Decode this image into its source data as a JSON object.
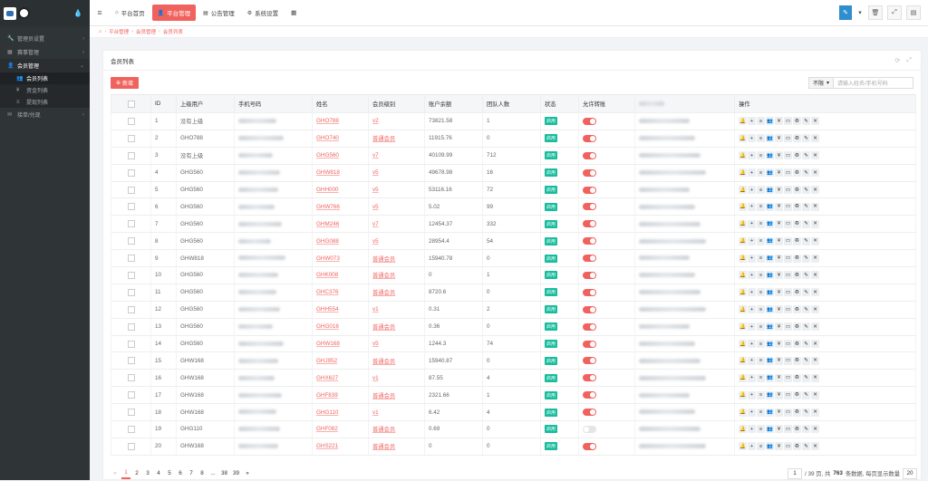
{
  "sidebar": {
    "menu": [
      {
        "label": "管理员设置",
        "icon": "wrench-icon",
        "glyph": "🔧",
        "expanded": false
      },
      {
        "label": "赛事管理",
        "icon": "table-icon",
        "glyph": "▦",
        "expanded": false
      },
      {
        "label": "会员管理",
        "icon": "user-icon",
        "glyph": "👤",
        "expanded": true,
        "children": [
          {
            "label": "会员列表",
            "glyph": "👥",
            "active": true
          },
          {
            "label": "资金列表",
            "glyph": "¥",
            "active": false
          },
          {
            "label": "提现列表",
            "glyph": "≡",
            "active": false
          }
        ]
      },
      {
        "label": "接单/兑现",
        "icon": "wechat-icon",
        "glyph": "✉",
        "expanded": false
      }
    ]
  },
  "topbar": {
    "tabs": [
      {
        "label": "平台首页",
        "glyph": "⌂",
        "active": false
      },
      {
        "label": "平台管理",
        "glyph": "👤",
        "active": true
      },
      {
        "label": "公告管理",
        "glyph": "▤",
        "active": false
      },
      {
        "label": "系统设置",
        "glyph": "⚙",
        "active": false
      }
    ]
  },
  "breadcrumb": [
    "平台管理",
    "会员管理",
    "会员列表"
  ],
  "panel": {
    "title": "会员列表",
    "add_label": "新增",
    "search_select": "不限",
    "search_placeholder": "请输入姓名/手机号码"
  },
  "table": {
    "headers": [
      "",
      "ID",
      "上级用户",
      "手机号码",
      "姓名",
      "会员级别",
      "账户余额",
      "团队人数",
      "状态",
      "允许转账",
      "",
      "操作"
    ],
    "status_label": "启用",
    "rows": [
      {
        "id": "1",
        "parent": "没有上级",
        "name": "GHO788",
        "level": "v2",
        "balance": "73821.58",
        "team": "1",
        "transfer": true
      },
      {
        "id": "2",
        "parent": "GHO788",
        "name": "GHO740",
        "level": "普通会员",
        "balance": "11915.76",
        "team": "0",
        "transfer": true
      },
      {
        "id": "3",
        "parent": "没有上级",
        "name": "GHG560",
        "level": "v7",
        "balance": "40109.99",
        "team": "712",
        "transfer": true
      },
      {
        "id": "4",
        "parent": "GHG560",
        "name": "GHW818",
        "level": "v5",
        "balance": "49678.98",
        "team": "16",
        "transfer": true
      },
      {
        "id": "5",
        "parent": "GHG560",
        "name": "GHH000",
        "level": "v5",
        "balance": "53116.16",
        "team": "72",
        "transfer": true
      },
      {
        "id": "6",
        "parent": "GHG560",
        "name": "GHW766",
        "level": "v5",
        "balance": "5.02",
        "team": "99",
        "transfer": true
      },
      {
        "id": "7",
        "parent": "GHG560",
        "name": "GHM246",
        "level": "v7",
        "balance": "12454.37",
        "team": "332",
        "transfer": true
      },
      {
        "id": "8",
        "parent": "GHG560",
        "name": "GHG088",
        "level": "v5",
        "balance": "28954.4",
        "team": "54",
        "transfer": true
      },
      {
        "id": "9",
        "parent": "GHW818",
        "name": "GHW073",
        "level": "普通会员",
        "balance": "15940.78",
        "team": "0",
        "transfer": true
      },
      {
        "id": "10",
        "parent": "GHG560",
        "name": "GHK008",
        "level": "普通会员",
        "balance": "0",
        "team": "1",
        "transfer": true
      },
      {
        "id": "11",
        "parent": "GHG560",
        "name": "GHC376",
        "level": "普通会员",
        "balance": "8720.6",
        "team": "0",
        "transfer": true
      },
      {
        "id": "12",
        "parent": "GHG560",
        "name": "GHH554",
        "level": "v1",
        "balance": "0.31",
        "team": "2",
        "transfer": true
      },
      {
        "id": "13",
        "parent": "GHG560",
        "name": "GHG016",
        "level": "普通会员",
        "balance": "0.36",
        "team": "0",
        "transfer": true
      },
      {
        "id": "14",
        "parent": "GHG560",
        "name": "GHW168",
        "level": "v5",
        "balance": "1244.3",
        "team": "74",
        "transfer": true
      },
      {
        "id": "15",
        "parent": "GHW168",
        "name": "GHJ952",
        "level": "普通会员",
        "balance": "15940.87",
        "team": "0",
        "transfer": true
      },
      {
        "id": "16",
        "parent": "GHW168",
        "name": "GHX627",
        "level": "v1",
        "balance": "87.55",
        "team": "4",
        "transfer": true
      },
      {
        "id": "17",
        "parent": "GHW168",
        "name": "GHF839",
        "level": "普通会员",
        "balance": "2321.66",
        "team": "1",
        "transfer": true
      },
      {
        "id": "18",
        "parent": "GHW168",
        "name": "GHG110",
        "level": "v1",
        "balance": "6.42",
        "team": "4",
        "transfer": true
      },
      {
        "id": "19",
        "parent": "GHG110",
        "name": "GHF082",
        "level": "普通会员",
        "balance": "0.69",
        "team": "0",
        "transfer": false
      },
      {
        "id": "20",
        "parent": "GHW168",
        "name": "GHS221",
        "level": "普通会员",
        "balance": "0",
        "team": "0",
        "transfer": true
      }
    ],
    "op_icons": [
      {
        "name": "bell-icon",
        "glyph": "🔔"
      },
      {
        "name": "plus-icon",
        "glyph": "+"
      },
      {
        "name": "list-icon",
        "glyph": "≡"
      },
      {
        "name": "users-icon",
        "glyph": "👥"
      },
      {
        "name": "yen-icon",
        "glyph": "¥"
      },
      {
        "name": "card-icon",
        "glyph": "▭"
      },
      {
        "name": "recycle-icon",
        "glyph": "♻"
      },
      {
        "name": "edit-icon",
        "glyph": "✎"
      },
      {
        "name": "delete-icon",
        "glyph": "✕"
      }
    ]
  },
  "pager": {
    "prev": "«",
    "pages": [
      "1",
      "2",
      "3",
      "4",
      "5",
      "6",
      "7",
      "8",
      "...",
      "38",
      "39"
    ],
    "next": "»",
    "current_page": "1",
    "page_input": "1",
    "total_pages_text": "/ 39 页, 共",
    "total_count": "763",
    "per_page_text": "条数据, 每页显示数量",
    "per_page": "20"
  }
}
